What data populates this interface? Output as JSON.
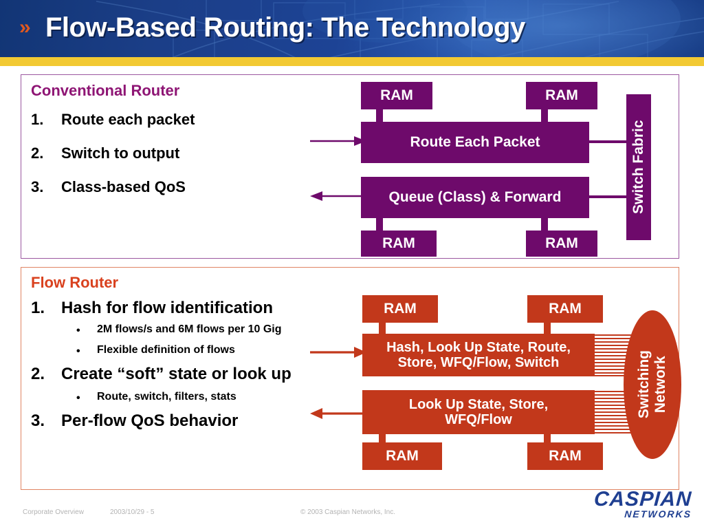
{
  "header": {
    "chevron_icon": "double-chevron-right-icon",
    "title": "Flow-Based Routing: The Technology",
    "band_color": "#f2c933",
    "background_color": "#1d4395"
  },
  "conventional": {
    "heading": "Conventional Router",
    "heading_color": "#8e1574",
    "accent_color": "#6e0a6b",
    "border_color": "#9b57a0",
    "items": [
      {
        "marker": "1.",
        "text": "Route each packet"
      },
      {
        "marker": "2.",
        "text": "Switch to output"
      },
      {
        "marker": "3.",
        "text": "Class-based QoS"
      }
    ],
    "diagram": {
      "ram_top_left": "RAM",
      "ram_top_right": "RAM",
      "ram_bottom_left": "RAM",
      "ram_bottom_right": "RAM",
      "bar_top": "Route Each Packet",
      "bar_bottom": "Queue (Class) & Forward",
      "fabric": "Switch Fabric",
      "arrow_in": "arrow-right-icon",
      "arrow_out": "arrow-left-icon"
    }
  },
  "flow": {
    "heading": "Flow Router",
    "heading_color": "#d9411e",
    "accent_color": "#c2381b",
    "border_color": "#e08463",
    "items": [
      {
        "marker": "1.",
        "text": "Hash for flow identification",
        "subitems": [
          "2M flows/s and 6M flows per 10 Gig",
          "Flexible definition of flows"
        ]
      },
      {
        "marker": "2.",
        "text": "Create “soft” state or look up",
        "subitems": [
          "Route, switch, filters, stats"
        ]
      },
      {
        "marker": "3.",
        "text": "Per-flow QoS behavior",
        "subitems": []
      }
    ],
    "diagram": {
      "ram_top_left": "RAM",
      "ram_top_right": "RAM",
      "ram_bottom_left": "RAM",
      "ram_bottom_right": "RAM",
      "bar_top_line1": "Hash, Look Up State, Route,",
      "bar_top_line2": "Store, WFQ/Flow, Switch",
      "bar_bottom_line1": "Look Up State, Store,",
      "bar_bottom_line2": "WFQ/Flow",
      "network_line1": "Switching",
      "network_line2": "Network",
      "arrow_in": "arrow-right-icon",
      "arrow_out": "arrow-left-icon"
    }
  },
  "footer": {
    "left": "Corporate Overview",
    "date": "2003/10/29 - 5",
    "copyright": "© 2003 Caspian Networks, Inc.",
    "logo_main": "CASPIAN",
    "logo_sub": "NETWORKS"
  }
}
